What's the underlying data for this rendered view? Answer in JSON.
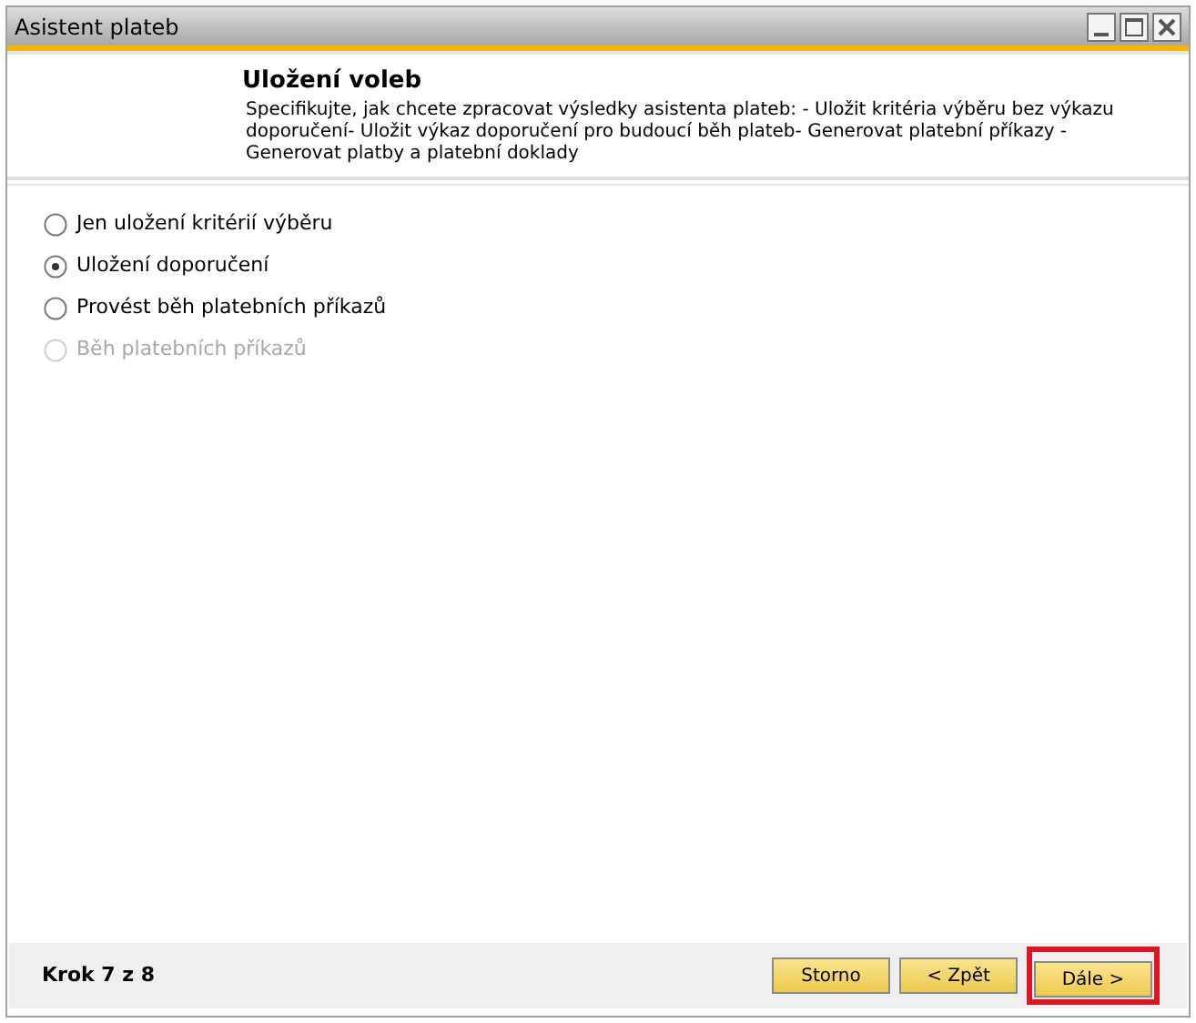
{
  "window": {
    "title": "Asistent plateb"
  },
  "header": {
    "title": "Uložení voleb",
    "description": "Specifikujte, jak chcete zpracovat výsledky asistenta plateb: - Uložit kritéria výběru bez výkazu doporučení- Uložit výkaz doporučení pro budoucí běh plateb- Generovat platební příkazy - Generovat platby a platební doklady"
  },
  "options": [
    {
      "label": "Jen uložení kritérií výběru",
      "selected": false,
      "disabled": false
    },
    {
      "label": "Uložení doporučení",
      "selected": true,
      "disabled": false
    },
    {
      "label": "Provést běh platebních příkazů",
      "selected": false,
      "disabled": false
    },
    {
      "label": "Běh platebních příkazů",
      "selected": false,
      "disabled": true
    }
  ],
  "footer": {
    "step": "Krok 7 z 8",
    "buttons": [
      {
        "label": "Storno",
        "highlighted": false
      },
      {
        "label": "< Zpět",
        "highlighted": false
      },
      {
        "label": "Dále >",
        "highlighted": true
      }
    ]
  }
}
